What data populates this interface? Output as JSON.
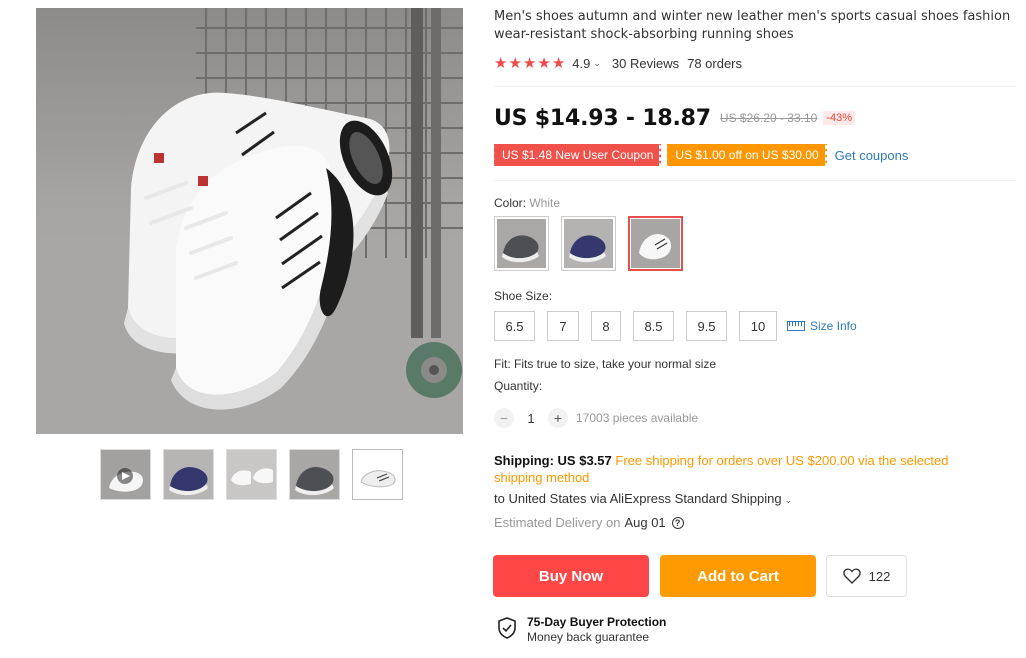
{
  "product": {
    "title": "Men's shoes autumn and winter new leather men's sports casual shoes fashion wear-resistant shock-absorbing running shoes",
    "rating": "4.9",
    "reviews": "30 Reviews",
    "orders": "78 orders",
    "stars": 5
  },
  "price": {
    "current": "US $14.93 - 18.87",
    "original": "US $26.20 - 33.10",
    "discount": "-43%"
  },
  "coupons": {
    "new_user": "US $1.48 New User Coupon",
    "off": "US $1.00 off on US $30.00",
    "get_link": "Get coupons"
  },
  "color": {
    "label": "Color:",
    "selected": "White",
    "options": [
      "gray-shoe",
      "navy-shoe",
      "white-shoe"
    ]
  },
  "size": {
    "label": "Shoe Size:",
    "options": [
      "6.5",
      "7",
      "8",
      "8.5",
      "9.5",
      "10"
    ],
    "info_link": "Size Info"
  },
  "fit": "Fit: Fits true to size, take your normal size",
  "quantity": {
    "label": "Quantity:",
    "minus": "−",
    "plus": "+",
    "value": "1",
    "available": "17003 pieces available"
  },
  "shipping": {
    "label": "Shipping: US $3.57",
    "free_note": "Free shipping for orders over US $200.00 via the selected shipping method",
    "to": "to United States via AliExpress Standard Shipping",
    "delivery_label": "Estimated Delivery on",
    "delivery_date": "Aug 01"
  },
  "actions": {
    "buy_now": "Buy Now",
    "add_to_cart": "Add to Cart",
    "wishlist_count": "122"
  },
  "protection": {
    "title": "75-Day Buyer Protection",
    "subtitle": "Money back guarantee"
  },
  "colors": {
    "accent_red": "#ff4747",
    "accent_orange": "#ff9a00",
    "link_blue": "#2e79bd",
    "star_red": "#f04a4a"
  }
}
